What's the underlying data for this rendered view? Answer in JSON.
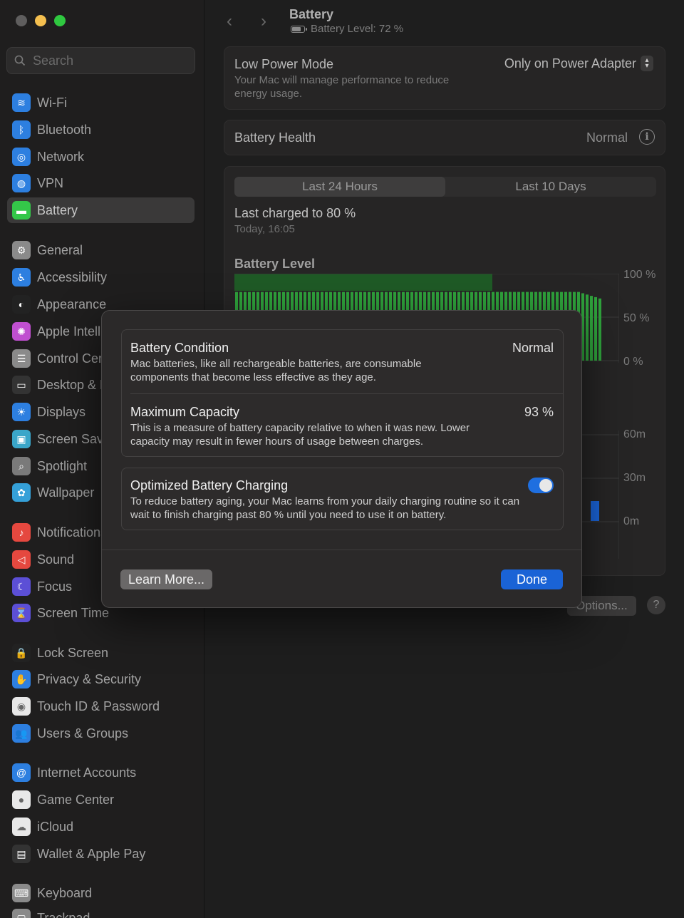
{
  "window": {
    "traffic_colors": [
      "#5f5e5e",
      "#f4bf4f",
      "#2fc840"
    ]
  },
  "sidebar": {
    "search_placeholder": "Search",
    "items": [
      {
        "label": "Wi-Fi",
        "icon": "wifi-icon",
        "color": "#2d7fe0",
        "glyph": "≋"
      },
      {
        "label": "Bluetooth",
        "icon": "bluetooth-icon",
        "color": "#2d7fe0",
        "glyph": "ᛒ"
      },
      {
        "label": "Network",
        "icon": "globe-icon",
        "color": "#2d7fe0",
        "glyph": "◎"
      },
      {
        "label": "VPN",
        "icon": "vpn-icon",
        "color": "#2d7fe0",
        "glyph": "◍"
      },
      {
        "label": "Battery",
        "icon": "battery-icon",
        "color": "#34c749",
        "glyph": "▬"
      },
      {
        "label": "General",
        "icon": "gear-icon",
        "color": "#8a8a8a",
        "glyph": "⚙"
      },
      {
        "label": "Accessibility",
        "icon": "accessibility-icon",
        "color": "#2d7fe0",
        "glyph": "♿"
      },
      {
        "label": "Appearance",
        "icon": "appearance-icon",
        "color": "#222222",
        "glyph": "◐"
      },
      {
        "label": "Apple Intelligence & Siri",
        "icon": "siri-icon",
        "color": "#c04fd0",
        "glyph": "✺"
      },
      {
        "label": "Control Centre",
        "icon": "control-centre-icon",
        "color": "#8a8a8a",
        "glyph": "☰"
      },
      {
        "label": "Desktop & Dock",
        "icon": "dock-icon",
        "color": "#333333",
        "glyph": "▭"
      },
      {
        "label": "Displays",
        "icon": "displays-icon",
        "color": "#2d7fe0",
        "glyph": "☀"
      },
      {
        "label": "Screen Saver",
        "icon": "screen-saver-icon",
        "color": "#3aa6c9",
        "glyph": "▣"
      },
      {
        "label": "Spotlight",
        "icon": "spotlight-icon",
        "color": "#7a7a7a",
        "glyph": "⌕"
      },
      {
        "label": "Wallpaper",
        "icon": "wallpaper-icon",
        "color": "#35a0d8",
        "glyph": "✿"
      },
      {
        "label": "Notifications",
        "icon": "bell-icon",
        "color": "#e5483f",
        "glyph": "♪"
      },
      {
        "label": "Sound",
        "icon": "speaker-icon",
        "color": "#e5483f",
        "glyph": "◁"
      },
      {
        "label": "Focus",
        "icon": "moon-icon",
        "color": "#5c4fd6",
        "glyph": "☾"
      },
      {
        "label": "Screen Time",
        "icon": "hourglass-icon",
        "color": "#5c4fd6",
        "glyph": "⌛"
      },
      {
        "label": "Lock Screen",
        "icon": "lock-icon",
        "color": "#222222",
        "glyph": "🔒"
      },
      {
        "label": "Privacy & Security",
        "icon": "hand-icon",
        "color": "#2d7fe0",
        "glyph": "✋"
      },
      {
        "label": "Touch ID & Password",
        "icon": "fingerprint-icon",
        "color": "#e8e8e8",
        "glyph": "◉"
      },
      {
        "label": "Users & Groups",
        "icon": "users-icon",
        "color": "#2d7fe0",
        "glyph": "👥"
      },
      {
        "label": "Internet Accounts",
        "icon": "at-icon",
        "color": "#2d7fe0",
        "glyph": "@"
      },
      {
        "label": "Game Center",
        "icon": "game-center-icon",
        "color": "#e8e8e8",
        "glyph": "●"
      },
      {
        "label": "iCloud",
        "icon": "cloud-icon",
        "color": "#e8e8e8",
        "glyph": "☁"
      },
      {
        "label": "Wallet & Apple Pay",
        "icon": "wallet-icon",
        "color": "#333333",
        "glyph": "▤"
      },
      {
        "label": "Keyboard",
        "icon": "keyboard-icon",
        "color": "#8a8a8a",
        "glyph": "⌨"
      },
      {
        "label": "Trackpad",
        "icon": "trackpad-icon",
        "color": "#8a8a8a",
        "glyph": "▢"
      }
    ]
  },
  "header": {
    "back_glyph": "‹",
    "forward_glyph": "›",
    "title": "Battery",
    "subtitle": "Battery Level: 72 %",
    "battery_level": 0.72
  },
  "low_power": {
    "title": "Low Power Mode",
    "desc": "Your Mac will manage performance to reduce energy usage.",
    "value": "Only on Power Adapter"
  },
  "health": {
    "title": "Battery Health",
    "value": "Normal",
    "info_glyph": "i"
  },
  "usage": {
    "tabs": [
      "Last 24 Hours",
      "Last 10 Days"
    ],
    "last_charged": "Last charged to 80 %",
    "last_charged_time": "Today, 16:05",
    "level_title": "Battery Level",
    "level_ticks": [
      "100 %",
      "50 %",
      "0 %"
    ],
    "usage_ticks": [
      "60m",
      "30m",
      "0m"
    ],
    "colors": {
      "bar": "#2fa33c",
      "band": "#1f5a26",
      "usage": "#1a63d6"
    }
  },
  "footer": {
    "options_label": "Options...",
    "help_glyph": "?"
  },
  "modal": {
    "condition": {
      "title": "Battery Condition",
      "value": "Normal",
      "desc": "Mac batteries, like all rechargeable batteries, are consumable components that become less effective as they age."
    },
    "capacity": {
      "title": "Maximum Capacity",
      "value": "93 %",
      "desc": "This is a measure of battery capacity relative to when it was new. Lower capacity may result in fewer hours of usage between charges."
    },
    "optimized": {
      "title": "Optimized Battery Charging",
      "desc": "To reduce battery aging, your Mac learns from your daily charging routine so it can wait to finish charging past 80 % until you need to use it on battery.",
      "enabled": true
    },
    "learn_more": "Learn More...",
    "done": "Done"
  }
}
